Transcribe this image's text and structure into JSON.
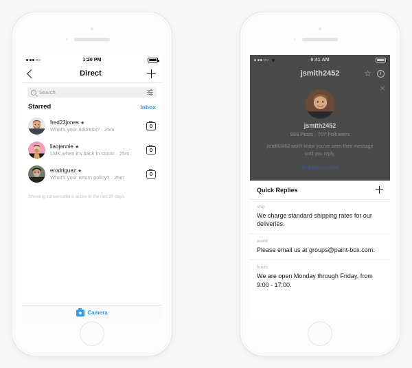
{
  "left_phone": {
    "status_bar": {
      "time": "1:20 PM",
      "signal": "signal-dots",
      "battery": "battery-icon"
    },
    "nav": {
      "back": "back-chevron",
      "title": "Direct",
      "add": "plus"
    },
    "search": {
      "placeholder": "Search",
      "value": "",
      "filter": "sliders-icon"
    },
    "section": {
      "title": "Starred",
      "link": "Inbox"
    },
    "conversations": [
      {
        "name": "fred23jones",
        "starred": "★",
        "preview": "What's your address? · 25m",
        "action": "camera"
      },
      {
        "name": "liaojannie",
        "starred": "★",
        "preview": "LMK when it's back in stock! · 25m",
        "action": "camera"
      },
      {
        "name": "erodriguez",
        "starred": "★",
        "preview": "What's your return policy? · 25m",
        "action": "camera"
      }
    ],
    "note": "Showing conversations active in the last 30 days.",
    "tab_bar": {
      "label": "Camera",
      "icon": "camera-icon"
    }
  },
  "right_phone": {
    "status_bar": {
      "time": "9:41 AM",
      "signal": "signal-dots",
      "wifi": "wifi-icon",
      "battery": "battery-icon"
    },
    "nav": {
      "title": "jsmith2452",
      "star": "☆",
      "info": "i"
    },
    "profile": {
      "close": "close-x",
      "name": "jsmith2452",
      "stats": "999 Posts  ·  707 Followers",
      "message": "jsmith2452 won't know you've seen their message until you reply.",
      "action": "Not interested"
    },
    "quick_replies": {
      "title": "Quick Replies",
      "add": "plus",
      "items": [
        {
          "shortcut": "ship",
          "text": "We charge standard shipping rates for our deliveries."
        },
        {
          "shortcut": "event",
          "text": "Please email us at groups@paint-box.com."
        },
        {
          "shortcut": "hours",
          "text": "We are open Monday through Friday, from 9:00 - 17:00."
        }
      ]
    }
  },
  "colors": {
    "accent": "#3897f0",
    "overlay": "#4a4a4a",
    "page_bg": "#f7f7f7"
  }
}
